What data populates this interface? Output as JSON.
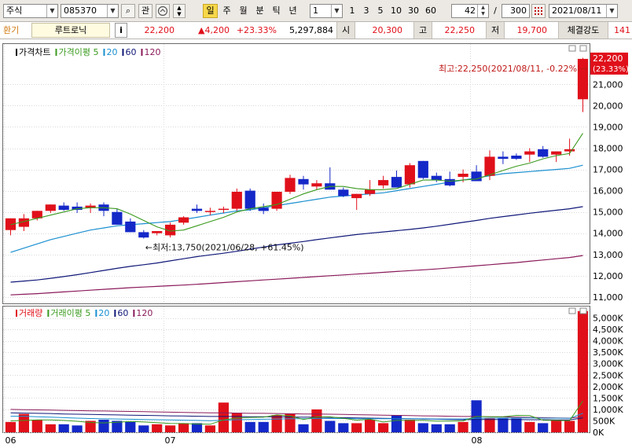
{
  "toolbar": {
    "market": "주식",
    "code": "085370",
    "btn_search_glyph": "⌕",
    "btn_interest": "관",
    "periods": [
      "일",
      "주",
      "월",
      "분",
      "틱",
      "년"
    ],
    "active_period": "일",
    "interval": "1",
    "intervals": [
      "1",
      "3",
      "5",
      "10",
      "30",
      "60"
    ],
    "count": "42",
    "sep": "/",
    "total": "300",
    "date": "2021/08/11"
  },
  "quote": {
    "label_env": "환기",
    "name": "루트로닉",
    "info_btn": "i",
    "price": "22,200",
    "change": "▲4,200",
    "rate": "+23.33%",
    "volume": "5,297,884",
    "open_label": "시",
    "open": "20,300",
    "high_label": "고",
    "high": "22,250",
    "low_label": "저",
    "low": "19,700",
    "strength_label": "체결강도",
    "strength": "141"
  },
  "colors": {
    "up": "#e0101a",
    "down": "#1428c8",
    "ma5": "#3a9a1e",
    "ma20": "#1a8fd0",
    "ma60": "#101878",
    "ma120": "#8a1a5a"
  },
  "chart_data": [
    {
      "type": "candlestick",
      "legend": [
        {
          "name": "가격차트",
          "color": "#000000"
        },
        {
          "name": "가격이평 5",
          "color": "#3a9a1e"
        },
        {
          "name": "20",
          "color": "#1a8fd0"
        },
        {
          "name": "60",
          "color": "#101878"
        },
        {
          "name": "120",
          "color": "#8a1a5a"
        }
      ],
      "ylim": [
        10700,
        22900
      ],
      "y_ticks": [
        "11,000",
        "12,000",
        "13,000",
        "14,000",
        "15,000",
        "16,000",
        "17,000",
        "18,000",
        "19,000",
        "20,000",
        "21,000"
      ],
      "price_tag": "22,200",
      "price_tag_rate": "(23.33%)",
      "x_ticks": [
        {
          "index": 0,
          "label": "06"
        },
        {
          "index": 12,
          "label": "07"
        },
        {
          "index": 35,
          "label": "08"
        }
      ],
      "ohlc": [
        [
          14150,
          14700,
          13900,
          14700
        ],
        [
          14300,
          14900,
          14100,
          14700
        ],
        [
          14700,
          15050,
          14600,
          15050
        ],
        [
          15050,
          15350,
          14950,
          15350
        ],
        [
          15300,
          15450,
          15050,
          15100
        ],
        [
          15250,
          15450,
          14950,
          15100
        ],
        [
          15200,
          15400,
          14950,
          15300
        ],
        [
          15350,
          15450,
          14800,
          15050
        ],
        [
          15000,
          15150,
          14400,
          14400
        ],
        [
          14550,
          14700,
          14050,
          14050
        ],
        [
          14050,
          14150,
          13750,
          13800
        ],
        [
          14000,
          14100,
          13900,
          14100
        ],
        [
          13900,
          14500,
          13800,
          14400
        ],
        [
          14500,
          14800,
          14400,
          14750
        ],
        [
          15150,
          15350,
          14950,
          15050
        ],
        [
          15050,
          15200,
          14850,
          15050
        ],
        [
          15150,
          15250,
          14950,
          15150
        ],
        [
          15150,
          16100,
          15050,
          15950
        ],
        [
          16000,
          16100,
          15050,
          15150
        ],
        [
          15200,
          15400,
          14900,
          15050
        ],
        [
          15150,
          15950,
          15050,
          15950
        ],
        [
          15950,
          16750,
          15850,
          16600
        ],
        [
          16550,
          16700,
          16050,
          16300
        ],
        [
          16200,
          16500,
          16050,
          16350
        ],
        [
          16350,
          17100,
          16050,
          16050
        ],
        [
          16050,
          16150,
          15700,
          15750
        ],
        [
          15650,
          15850,
          15100,
          15850
        ],
        [
          15850,
          16500,
          15750,
          16050
        ],
        [
          16250,
          16700,
          16100,
          16500
        ],
        [
          16650,
          16950,
          16350,
          16150
        ],
        [
          16300,
          17300,
          16150,
          17200
        ],
        [
          17400,
          17400,
          16550,
          16600
        ],
        [
          16700,
          16850,
          16400,
          16500
        ],
        [
          16550,
          16900,
          16200,
          16250
        ],
        [
          16650,
          17000,
          16400,
          16800
        ],
        [
          16900,
          17200,
          16550,
          16450
        ],
        [
          16700,
          17900,
          16500,
          17600
        ],
        [
          17600,
          17850,
          17250,
          17500
        ],
        [
          17650,
          17750,
          17450,
          17500
        ],
        [
          17700,
          18000,
          17350,
          17850
        ],
        [
          17950,
          18100,
          17550,
          17600
        ],
        [
          17700,
          17850,
          17350,
          17850
        ],
        [
          17850,
          18450,
          17650,
          17950
        ],
        [
          20300,
          22250,
          19700,
          22200
        ]
      ],
      "ma5": [
        14400,
        14550,
        14700,
        14850,
        15000,
        15150,
        15200,
        15200,
        15150,
        14900,
        14600,
        14300,
        14100,
        14150,
        14350,
        14550,
        14750,
        15000,
        15150,
        15250,
        15350,
        15600,
        15850,
        16050,
        16200,
        16200,
        16100,
        16050,
        16050,
        16100,
        16300,
        16500,
        16500,
        16450,
        16500,
        16550,
        16750,
        16950,
        17150,
        17300,
        17500,
        17650,
        17750,
        18700
      ],
      "ma20": [
        13100,
        13300,
        13500,
        13700,
        13850,
        14000,
        14150,
        14250,
        14350,
        14400,
        14450,
        14500,
        14550,
        14650,
        14750,
        14850,
        14950,
        15050,
        15100,
        15200,
        15300,
        15400,
        15500,
        15600,
        15700,
        15750,
        15800,
        15850,
        15900,
        16000,
        16100,
        16200,
        16300,
        16400,
        16500,
        16600,
        16700,
        16800,
        16850,
        16900,
        16950,
        17000,
        17050,
        17200
      ],
      "ma60": [
        11700,
        11750,
        11800,
        11880,
        11960,
        12050,
        12150,
        12250,
        12350,
        12440,
        12520,
        12600,
        12700,
        12800,
        12900,
        12980,
        13060,
        13150,
        13250,
        13350,
        13450,
        13530,
        13610,
        13700,
        13780,
        13860,
        13940,
        14000,
        14060,
        14120,
        14180,
        14250,
        14330,
        14420,
        14510,
        14600,
        14700,
        14780,
        14860,
        14940,
        15010,
        15080,
        15150,
        15250
      ],
      "ma120": [
        11100,
        11130,
        11160,
        11200,
        11240,
        11280,
        11320,
        11360,
        11400,
        11440,
        11470,
        11500,
        11530,
        11560,
        11600,
        11640,
        11680,
        11720,
        11760,
        11800,
        11840,
        11880,
        11920,
        11960,
        12000,
        12040,
        12080,
        12120,
        12160,
        12200,
        12240,
        12280,
        12320,
        12370,
        12420,
        12470,
        12520,
        12570,
        12620,
        12680,
        12740,
        12800,
        12860,
        12950
      ],
      "annotations": [
        {
          "text": "최고:22,250(2021/08/11, -0.22%)→",
          "index": 43
        },
        {
          "text": "←최저:13,750(2021/06/28, +61.45%)",
          "index": 10
        }
      ]
    },
    {
      "type": "bar",
      "legend": [
        {
          "name": "거래량",
          "color": "#e0101a"
        },
        {
          "name": "거래이평 5",
          "color": "#3a9a1e"
        },
        {
          "name": "20",
          "color": "#1a8fd0"
        },
        {
          "name": "60",
          "color": "#101878"
        },
        {
          "name": "120",
          "color": "#8a1a5a"
        }
      ],
      "ylim": [
        0,
        5500000
      ],
      "y_ticks": [
        "0K",
        "500K",
        "1,000K",
        "1,500K",
        "2,000K",
        "2,500K",
        "3,000K",
        "3,500K",
        "4,000K",
        "4,500K",
        "5,000K"
      ],
      "values": [
        450000,
        800000,
        550000,
        350000,
        350000,
        300000,
        500000,
        550000,
        500000,
        450000,
        300000,
        350000,
        300000,
        400000,
        400000,
        300000,
        1300000,
        850000,
        450000,
        450000,
        750000,
        800000,
        350000,
        1000000,
        500000,
        400000,
        400000,
        550000,
        400000,
        750000,
        550000,
        400000,
        350000,
        350000,
        450000,
        1400000,
        600000,
        600000,
        600000,
        450000,
        400000,
        550000,
        500000,
        5300000
      ],
      "ma5": [
        500000,
        520000,
        540000,
        540000,
        520000,
        480000,
        430000,
        410000,
        440000,
        470000,
        450000,
        420000,
        390000,
        380000,
        360000,
        350000,
        540000,
        630000,
        650000,
        660000,
        760000,
        710000,
        560000,
        670000,
        680000,
        610000,
        530000,
        570000,
        450000,
        520000,
        520000,
        520000,
        490000,
        490000,
        500000,
        690000,
        680000,
        680000,
        740000,
        730000,
        530000,
        520000,
        510000,
        1370000
      ],
      "ma20": [
        700000,
        700000,
        680000,
        660000,
        640000,
        620000,
        600000,
        590000,
        580000,
        570000,
        560000,
        550000,
        540000,
        530000,
        520000,
        510000,
        530000,
        550000,
        560000,
        570000,
        580000,
        590000,
        590000,
        600000,
        600000,
        600000,
        590000,
        590000,
        590000,
        590000,
        590000,
        590000,
        580000,
        580000,
        580000,
        610000,
        620000,
        620000,
        630000,
        630000,
        620000,
        620000,
        610000,
        830000
      ],
      "ma60": [
        850000,
        840000,
        830000,
        820000,
        800000,
        790000,
        780000,
        770000,
        760000,
        750000,
        740000,
        730000,
        720000,
        710000,
        700000,
        690000,
        690000,
        690000,
        680000,
        680000,
        680000,
        670000,
        660000,
        660000,
        650000,
        640000,
        630000,
        620000,
        610000,
        600000,
        590000,
        580000,
        570000,
        560000,
        550000,
        560000,
        560000,
        560000,
        560000,
        550000,
        550000,
        540000,
        540000,
        630000
      ],
      "ma120": [
        1000000,
        990000,
        980000,
        970000,
        960000,
        950000,
        940000,
        930000,
        920000,
        910000,
        900000,
        890000,
        880000,
        870000,
        860000,
        850000,
        850000,
        840000,
        830000,
        830000,
        820000,
        810000,
        800000,
        800000,
        790000,
        780000,
        770000,
        760000,
        750000,
        740000,
        730000,
        720000,
        710000,
        700000,
        690000,
        690000,
        680000,
        670000,
        660000,
        650000,
        640000,
        630000,
        620000,
        680000
      ]
    }
  ]
}
